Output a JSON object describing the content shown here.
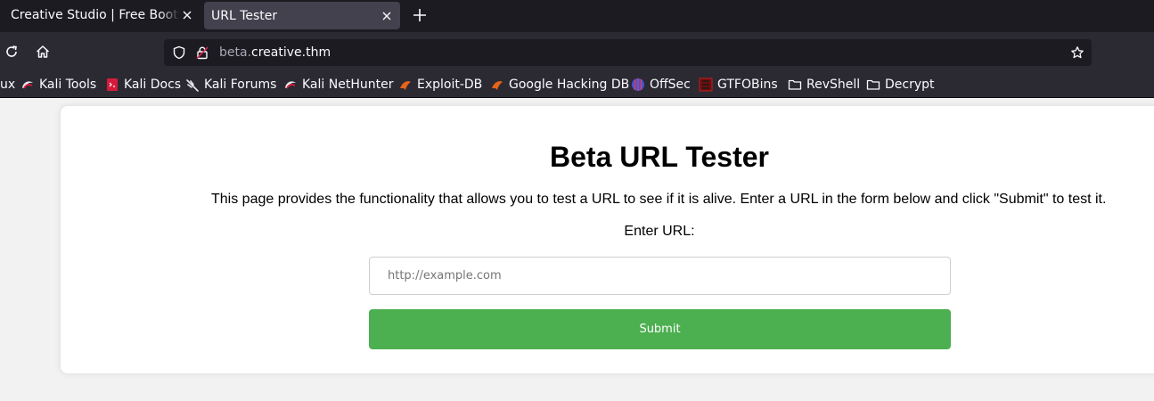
{
  "browser": {
    "tabs": [
      {
        "label": "Creative Studio | Free Bootstrap"
      },
      {
        "label": "URL Tester"
      }
    ],
    "url": {
      "subdomain": "beta.",
      "domain": "creative.thm"
    },
    "bookmarks": [
      {
        "label": "ux",
        "icon": "kali-icon"
      },
      {
        "label": "Kali Tools",
        "icon": "kali-icon"
      },
      {
        "label": "Kali Docs",
        "icon": "kali-docs-icon"
      },
      {
        "label": "Kali Forums",
        "icon": "kali-dragon-icon"
      },
      {
        "label": "Kali NetHunter",
        "icon": "kali-icon"
      },
      {
        "label": "Exploit-DB",
        "icon": "exploit-db-icon"
      },
      {
        "label": "Google Hacking DB",
        "icon": "exploit-db-icon"
      },
      {
        "label": "OffSec",
        "icon": "offsec-icon"
      },
      {
        "label": "GTFOBins",
        "icon": "gtfobins-icon"
      },
      {
        "label": "RevShell",
        "icon": "folder-icon"
      },
      {
        "label": "Decrypt",
        "icon": "folder-icon"
      }
    ]
  },
  "page": {
    "title": "Beta URL Tester",
    "description": "This page provides the functionality that allows you to test a URL to see if it is alive. Enter a URL in the form below and click \"Submit\" to test it.",
    "form": {
      "label": "Enter URL:",
      "placeholder": "http://example.com",
      "value": "",
      "submit_label": "Submit"
    }
  },
  "colors": {
    "submit_button": "#4caf50",
    "page_background": "#f2f2f2",
    "browser_chrome": "#2b2a33"
  }
}
